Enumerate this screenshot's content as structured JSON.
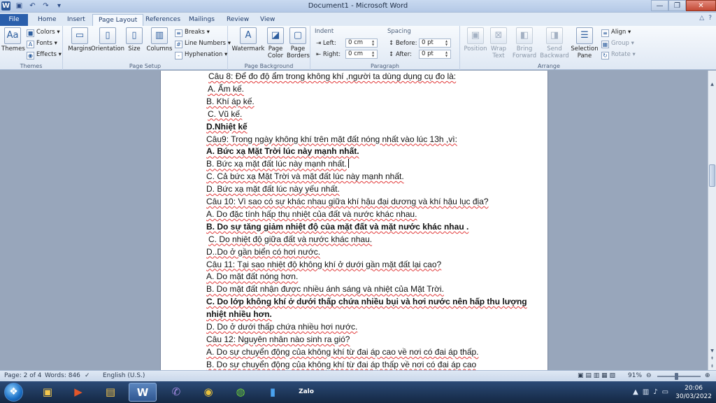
{
  "titlebar": {
    "title": "Document1 - Microsoft Word",
    "qat_icons": [
      "word-logo",
      "save-icon",
      "undo-icon",
      "redo-icon",
      "dropdown-icon"
    ]
  },
  "tabs": {
    "file": "File",
    "items": [
      "Home",
      "Insert",
      "Page Layout",
      "References",
      "Mailings",
      "Review",
      "View"
    ],
    "active": "Page Layout",
    "help": "?"
  },
  "ribbon": {
    "themes": {
      "group_label": "Themes",
      "themes_label": "Themes",
      "colors": "Colors",
      "fonts": "Fonts",
      "effects": "Effects"
    },
    "page_setup": {
      "group_label": "Page Setup",
      "margins": "Margins",
      "orientation": "Orientation",
      "size": "Size",
      "columns": "Columns",
      "breaks": "Breaks",
      "line_numbers": "Line Numbers",
      "hyphenation": "Hyphenation"
    },
    "page_background": {
      "group_label": "Page Background",
      "watermark": "Watermark",
      "page_color": "Page Color",
      "page_borders": "Page Borders"
    },
    "paragraph": {
      "group_label": "Paragraph",
      "indent_label": "Indent",
      "left_label": "Left:",
      "left_value": "0 cm",
      "right_label": "Right:",
      "right_value": "0 cm",
      "spacing_label": "Spacing",
      "before_label": "Before:",
      "before_value": "0 pt",
      "after_label": "After:",
      "after_value": "0 pt"
    },
    "arrange": {
      "group_label": "Arrange",
      "position": "Position",
      "wrap_text": "Wrap Text",
      "bring_forward": "Bring Forward",
      "send_backward": "Send Backward",
      "selection_pane": "Selection Pane",
      "align": "Align",
      "group": "Group",
      "rotate": "Rotate"
    }
  },
  "document": {
    "lines": [
      {
        "text": "Câu 8: Để đo độ ẩm trong không khí ,người ta dùng dụng cụ đo là:",
        "bold": false,
        "indent": 3
      },
      {
        "text": "A. Ẩm kế.",
        "bold": false,
        "indent": 2
      },
      {
        "text": "B. Khí áp kế.",
        "bold": false,
        "indent": 0
      },
      {
        "text": "C. Vũ kế.",
        "bold": false,
        "indent": 2
      },
      {
        "text": "D.Nhiệt kế",
        "bold": true,
        "indent": 0
      },
      {
        "text": "Câu9: Trong ngày không khí trên mặt đất nóng nhất vào lúc 13h ,vì:",
        "bold": false,
        "indent": 0
      },
      {
        "text": "A. Bức xạ Mặt Trời lúc này mạnh nhất.",
        "bold": true,
        "indent": 0
      },
      {
        "text": "B. Bức xạ mặt đất lúc này mạnh nhất.",
        "bold": false,
        "indent": 0,
        "cursor": true
      },
      {
        "text": "C. Cả bức xạ Mặt Trời và mặt đất lúc này mạnh nhất.",
        "bold": false,
        "indent": 0
      },
      {
        "text": "D. Bức xạ mặt đất lúc này yếu nhất.",
        "bold": false,
        "indent": 0
      },
      {
        "text": "Câu 10: Vì sao có sự khác nhau giữa khí hậu đại dương và khí hậu lục địa?",
        "bold": false,
        "indent": 0
      },
      {
        "text": "A. Do đặc tính hấp thụ nhiệt của đất và nước khác nhau.",
        "bold": false,
        "indent": 0
      },
      {
        "text": "B. Do sự tăng giảm nhiệt độ của mặt đất và mặt nước khác nhau .",
        "bold": true,
        "indent": 0
      },
      {
        "text": "C. Do nhiệt độ giữa đất và nước khác nhau.",
        "bold": false,
        "indent": 3
      },
      {
        "text": "D..Do ở gần biển có hơi nước.",
        "bold": false,
        "indent": 0
      },
      {
        "text": "Câu 11: Tại sao nhiệt độ không khí ở dưới gần mặt đất lại cao?",
        "bold": false,
        "indent": 0
      },
      {
        "text": "A. Do mặt đất nóng hơn.",
        "bold": false,
        "indent": 0
      },
      {
        "text": "B. Do mặt đất nhận được nhiều ánh sáng và nhiệt của Mặt Trời.",
        "bold": false,
        "indent": 0
      },
      {
        "text": "C. Do lớp không khí ở dưới thấp chứa nhiều bụi và hơi nước nên hấp thu lượng",
        "bold": true,
        "indent": 0
      },
      {
        "text": "nhiệt nhiều hơn.",
        "bold": true,
        "indent": 0
      },
      {
        "text": "D. Do ở dưới thấp chứa nhiều hơi nước.",
        "bold": false,
        "indent": 0
      },
      {
        "text": "Câu 12: Nguyên nhân nào sinh ra gió?",
        "bold": false,
        "indent": 0
      },
      {
        "text": "A. Do sự chuyển động của không khí từ đai áp cao về nơi có đai áp thấp.",
        "bold": false,
        "indent": 0
      },
      {
        "text": "B. Do sự chuyển động của không khí từ đai áp thấp về nơi có đai áp cao",
        "bold": false,
        "indent": 0
      }
    ]
  },
  "statusbar": {
    "page": "Page: 2 of 4",
    "words": "Words: 846",
    "language": "English (U.S.)",
    "zoom": "91%",
    "zoom_level": 0.91
  },
  "taskbar": {
    "apps": [
      "explorer",
      "media-player",
      "file-manager",
      "word",
      "viber",
      "chrome",
      "camtasia",
      "zoom",
      "zalo"
    ],
    "zalo_label": "Zalo",
    "time": "20:06",
    "date": "30/03/2022"
  },
  "colors": {
    "file_tab": "#2a5fac",
    "accent": "#2b5797",
    "squiggle": "#e23a3a"
  }
}
